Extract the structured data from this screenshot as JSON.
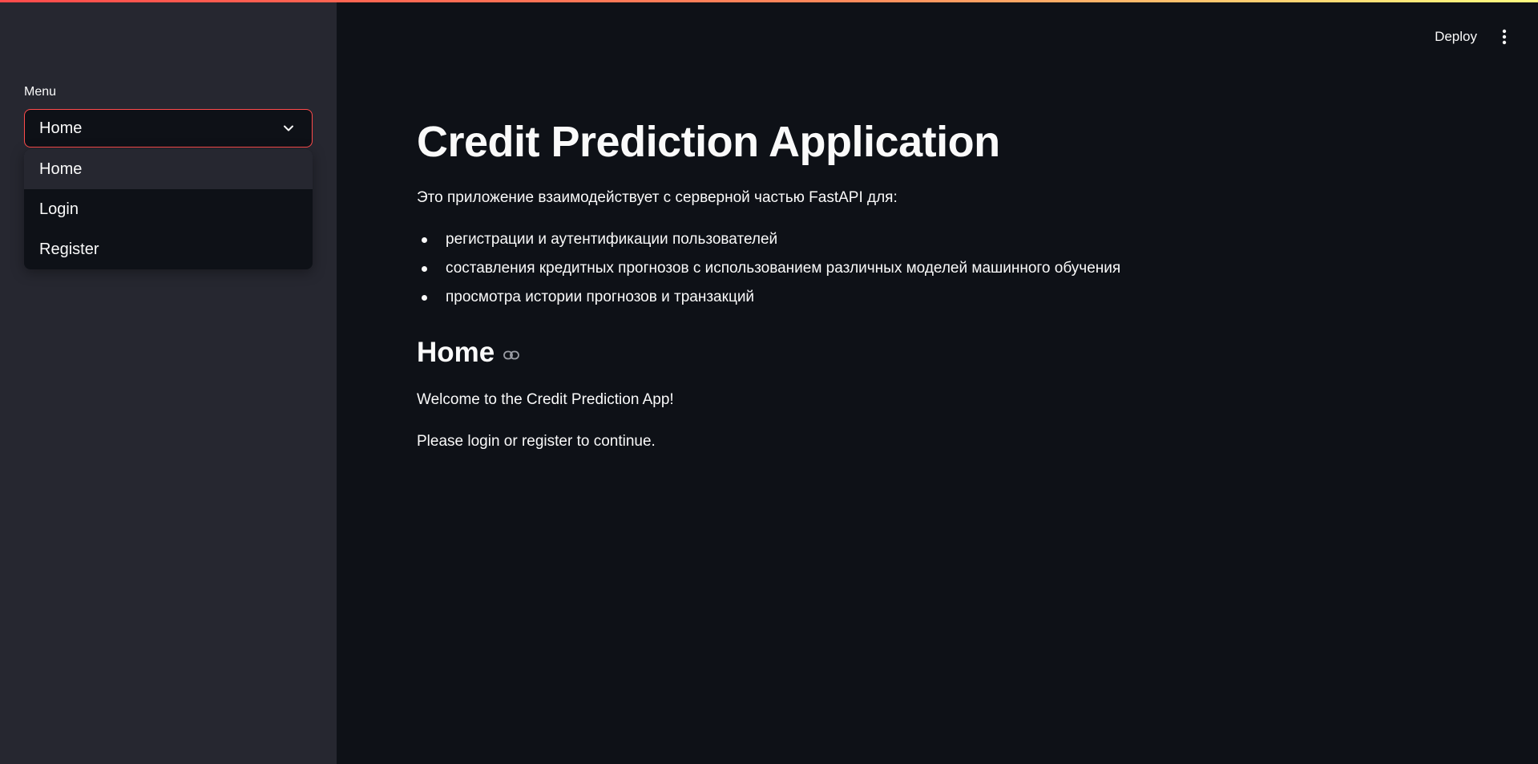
{
  "sidebar": {
    "menu_label": "Menu",
    "select": {
      "value": "Home"
    },
    "options": [
      {
        "label": "Home"
      },
      {
        "label": "Login"
      },
      {
        "label": "Register"
      }
    ]
  },
  "header": {
    "deploy_label": "Deploy",
    "menu_icon": "kebab-vertical-icon"
  },
  "main": {
    "title": "Credit Prediction Application",
    "intro": "Это приложение взаимодействует с серверной частью FastAPI для:",
    "bullets": [
      "регистрации и аутентификации пользователей",
      "составления кредитных прогнозов с использованием различных моделей машинного обучения",
      "просмотра истории прогнозов и транзакций"
    ],
    "section_title": "Home",
    "section_anchor_icon": "link-icon",
    "welcome": "Welcome to the Credit Prediction App!",
    "prompt": "Please login or register to continue."
  },
  "colors": {
    "background": "#0e1117",
    "sidebar": "#262730",
    "accent": "#ff4b4b",
    "text": "#fafafa"
  }
}
